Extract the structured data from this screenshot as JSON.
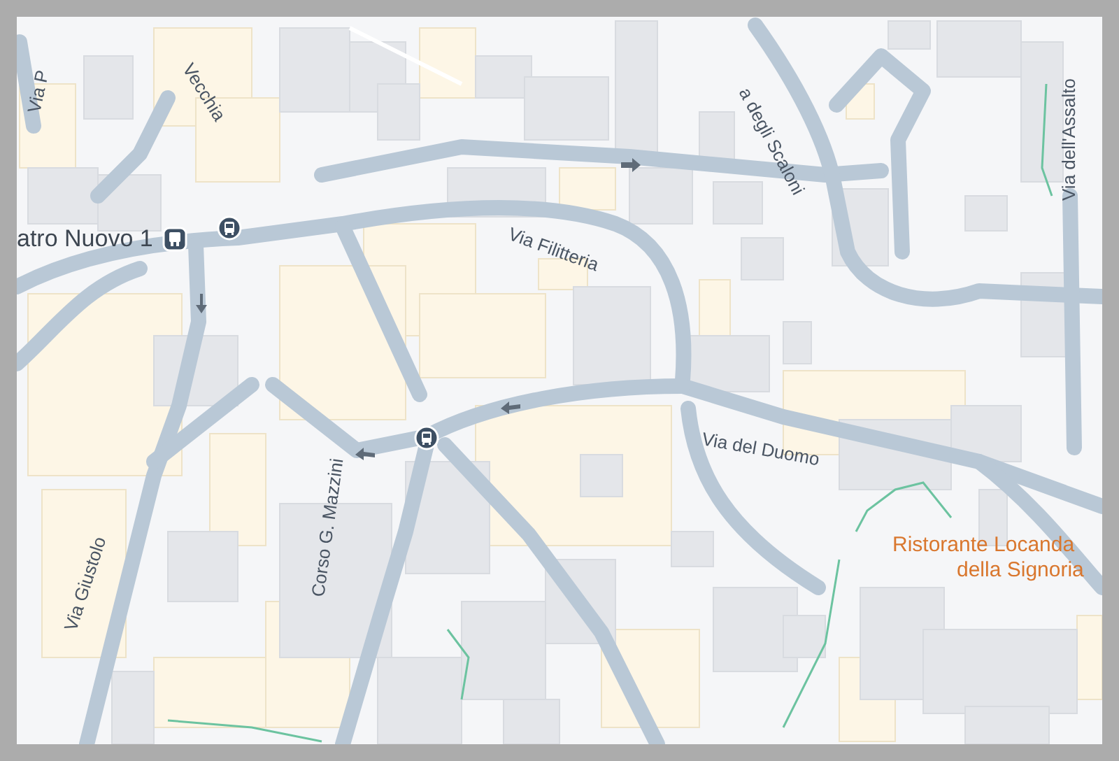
{
  "map": {
    "labels": [
      {
        "kind": "street",
        "text": "Via P"
      },
      {
        "kind": "street",
        "text": "Vecchia"
      },
      {
        "kind": "street",
        "text": "a degli Scaloni"
      },
      {
        "kind": "street",
        "text": "Via dell'Assalto"
      },
      {
        "kind": "street",
        "text": "atro Nuovo 1"
      },
      {
        "kind": "street",
        "text": "Via Filitteria"
      },
      {
        "kind": "street",
        "text": "Via del Duomo"
      },
      {
        "kind": "street",
        "text": "Corso G. Mazzini"
      },
      {
        "kind": "street",
        "text": "Via Giustolo"
      },
      {
        "kind": "place",
        "text": "Ristorante Locanda"
      },
      {
        "kind": "place",
        "text": "della Signoria"
      }
    ],
    "stops": [
      {
        "kind": "tram"
      },
      {
        "kind": "bus"
      },
      {
        "kind": "bus"
      }
    ]
  }
}
